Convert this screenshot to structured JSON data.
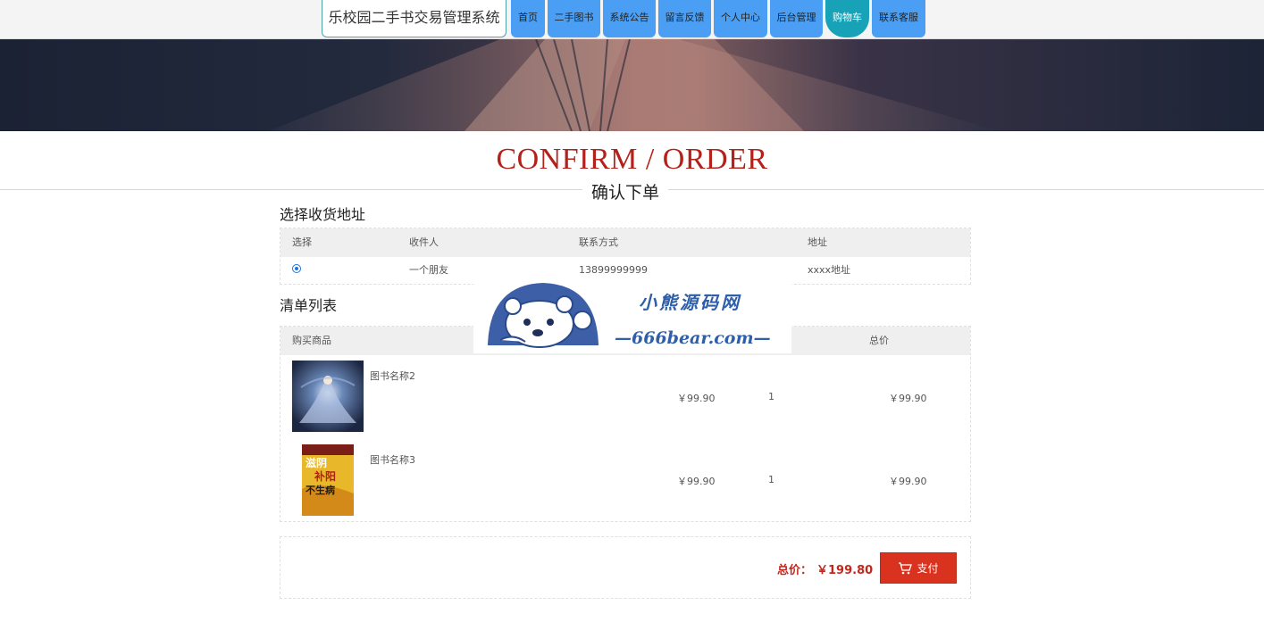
{
  "app": {
    "title": "乐校园二手书交易管理系统"
  },
  "nav": [
    {
      "label": "首页",
      "active": false
    },
    {
      "label": "二手图书",
      "active": false
    },
    {
      "label": "系统公告",
      "active": false
    },
    {
      "label": "留言反馈",
      "active": false
    },
    {
      "label": "个人中心",
      "active": false
    },
    {
      "label": "后台管理",
      "active": false
    },
    {
      "label": "购物车",
      "active": true
    },
    {
      "label": "联系客服",
      "active": false
    }
  ],
  "heading": {
    "en": "CONFIRM / ORDER",
    "zh": "确认下单"
  },
  "address": {
    "section_title": "选择收货地址",
    "columns": [
      "选择",
      "收件人",
      "联系方式",
      "地址"
    ],
    "rows": [
      {
        "selected": true,
        "recipient": "一个朋友",
        "phone": "13899999999",
        "address": "xxxx地址"
      }
    ]
  },
  "order": {
    "section_title": "清单列表",
    "columns": [
      "购买商品",
      "总价"
    ],
    "items": [
      {
        "name": "图书名称2",
        "price": "￥99.90",
        "qty": "1",
        "total": "￥99.90",
        "cover": "fantasy-cover"
      },
      {
        "name": "图书名称3",
        "price": "￥99.90",
        "qty": "1",
        "total": "￥99.90",
        "cover": "yellow-cover",
        "cover_text": "滋阴补阳不生病"
      }
    ]
  },
  "summary": {
    "label": "总价：",
    "value": "￥199.80",
    "pay_label": "支付"
  },
  "watermark": {
    "top": "小熊源码网",
    "bottom": "—666bear.com—"
  },
  "colors": {
    "accent": "#b4201a",
    "nav": "#4a9ff5",
    "nav_active": "#17a2b8",
    "pay": "#d9321f"
  }
}
